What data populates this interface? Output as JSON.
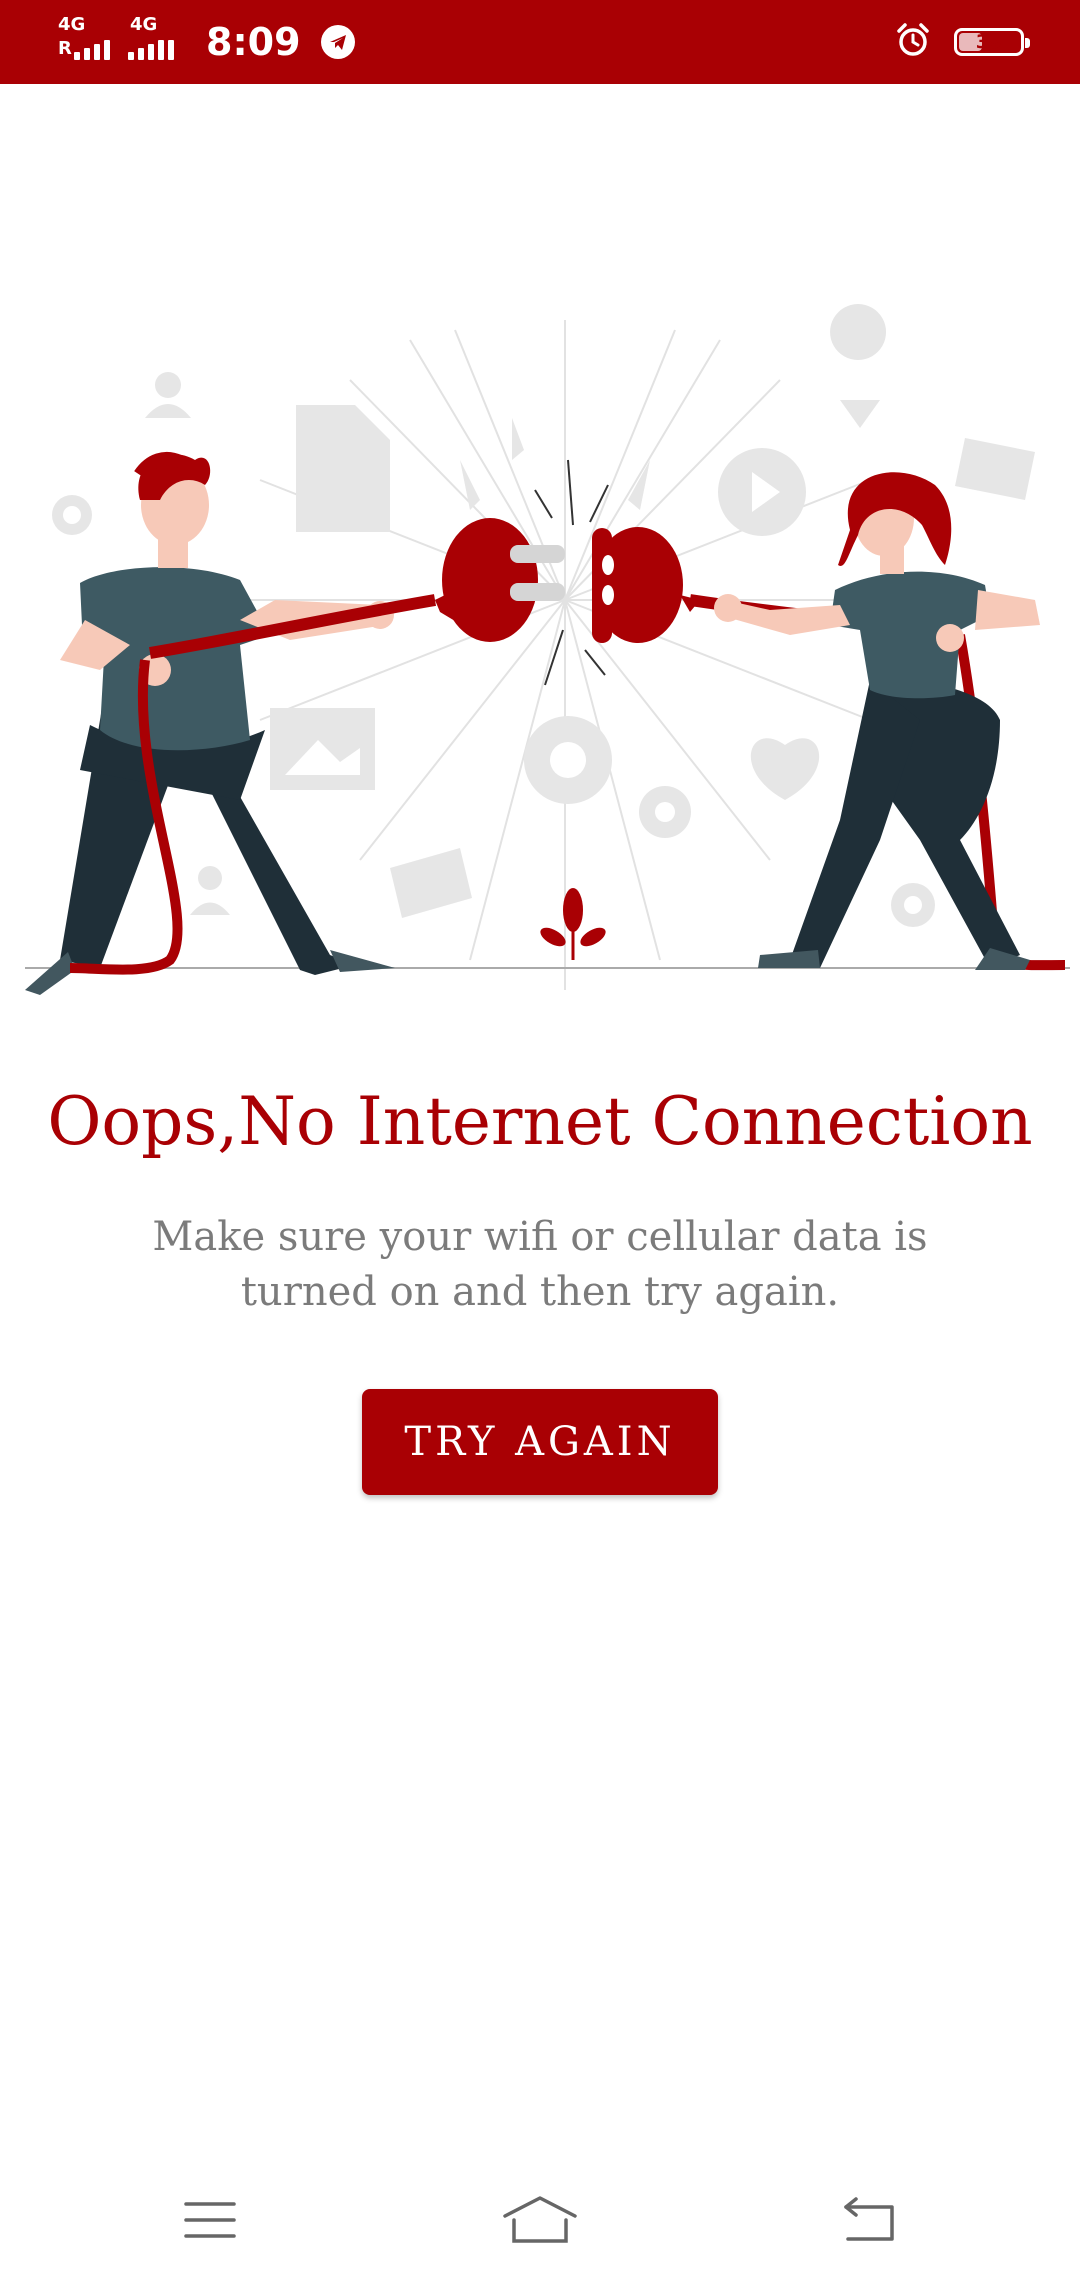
{
  "status_bar": {
    "network_1": "4G",
    "network_1_sub": "R",
    "network_2": "4G",
    "time": "8:09",
    "battery_percent": "39",
    "battery_level": 0.39,
    "icons": [
      "signal-icon",
      "telegram-icon",
      "alarm-icon",
      "battery-icon"
    ]
  },
  "main": {
    "title": "Oops,No Internet Connection",
    "message": "Make sure your wifi or cellular data is turned on and then try again.",
    "button_label": "TRY AGAIN"
  },
  "navigation": {
    "icons": [
      "menu-icon",
      "home-icon",
      "back-icon"
    ]
  },
  "colors": {
    "accent": "#a90004",
    "text_secondary": "#7b7b7b",
    "background": "#ffffff"
  }
}
